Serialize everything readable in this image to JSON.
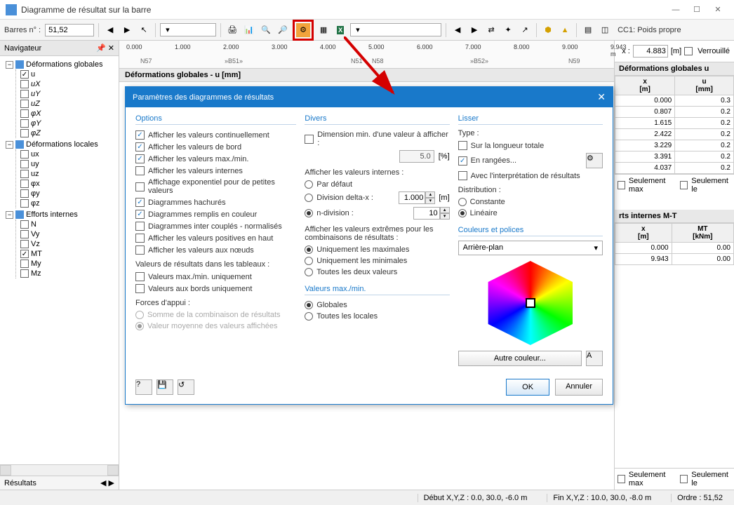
{
  "window": {
    "title": "Diagramme de résultat sur la barre"
  },
  "toolbar": {
    "barres_label": "Barres n° :",
    "barres_value": "51,52",
    "cc_label": "CC1: Poids propre"
  },
  "navigator": {
    "title": "Navigateur",
    "footer": "Résultats",
    "groups": [
      {
        "label": "Déformations globales",
        "expanded": true,
        "items": [
          {
            "label": "u",
            "checked": true
          },
          {
            "label": "uX",
            "checked": false,
            "style": "italic"
          },
          {
            "label": "uY",
            "checked": false,
            "style": "italic"
          },
          {
            "label": "uZ",
            "checked": false,
            "style": "italic"
          },
          {
            "label": "φX",
            "checked": false,
            "style": "italic"
          },
          {
            "label": "φY",
            "checked": false,
            "style": "italic"
          },
          {
            "label": "φZ",
            "checked": false,
            "style": "italic"
          }
        ]
      },
      {
        "label": "Déformations locales",
        "expanded": true,
        "items": [
          {
            "label": "ux",
            "checked": false
          },
          {
            "label": "uy",
            "checked": false
          },
          {
            "label": "uz",
            "checked": false
          },
          {
            "label": "φx",
            "checked": false
          },
          {
            "label": "φy",
            "checked": false
          },
          {
            "label": "φz",
            "checked": false
          }
        ]
      },
      {
        "label": "Efforts internes",
        "expanded": true,
        "items": [
          {
            "label": "N",
            "checked": false
          },
          {
            "label": "Vy",
            "checked": false
          },
          {
            "label": "Vz",
            "checked": false
          },
          {
            "label": "MT",
            "checked": true
          },
          {
            "label": "My",
            "checked": false
          },
          {
            "label": "Mz",
            "checked": false
          }
        ]
      }
    ]
  },
  "ruler": {
    "ticks": [
      "0.000",
      "1.000",
      "2.000",
      "3.000",
      "4.000",
      "5.000",
      "6.000",
      "7.000",
      "8.000",
      "9.000",
      "9.943 m"
    ],
    "nodes_left": [
      "N57",
      "»B51»"
    ],
    "nodes_mid": [
      "N51",
      "N58"
    ],
    "nodes_right": [
      "»B52»",
      "N59"
    ]
  },
  "section_header": "Déformations globales - u [mm]",
  "right": {
    "x_label": "x :",
    "x_value": "4.883",
    "x_unit": "[m]",
    "lock_label": "Verrouillé",
    "table1": {
      "title": "Déformations globales u",
      "col1": "x\n[m]",
      "col2": "u\n[mm]",
      "rows": [
        [
          "0.000",
          "0.3"
        ],
        [
          "0.807",
          "0.2"
        ],
        [
          "1.615",
          "0.2"
        ],
        [
          "2.422",
          "0.2"
        ],
        [
          "3.229",
          "0.2"
        ],
        [
          "3.391",
          "0.2"
        ],
        [
          "4.037",
          "0.2"
        ]
      ]
    },
    "table2": {
      "title": "rts internes M-T",
      "col1": "x\n[m]",
      "col2": "MT\n[kNm]",
      "rows": [
        [
          "0.000",
          "0.00"
        ],
        [
          "9.943",
          "0.00"
        ]
      ]
    },
    "footer_max": "Seulement max",
    "footer_le": "Seulement le"
  },
  "dialog": {
    "title": "Paramètres des diagrammes de résultats",
    "options": {
      "heading": "Options",
      "items": [
        {
          "label": "Afficher les valeurs continuellement",
          "checked": true
        },
        {
          "label": "Afficher les valeurs de bord",
          "checked": true
        },
        {
          "label": "Afficher les valeurs max./min.",
          "checked": true
        },
        {
          "label": "Afficher les valeurs internes",
          "checked": false
        },
        {
          "label": "Affichage exponentiel pour de petites valeurs",
          "checked": false
        },
        {
          "label": "Diagrammes hachurés",
          "checked": true
        },
        {
          "label": "Diagrammes remplis en couleur",
          "checked": true
        },
        {
          "label": "Diagrammes inter couplés - normalisés",
          "checked": false
        },
        {
          "label": "Afficher les valeurs positives en haut",
          "checked": false
        },
        {
          "label": "Afficher les valeurs aux nœuds",
          "checked": false
        }
      ],
      "tables_heading": "Valeurs de résultats dans les tableaux :",
      "tables_items": [
        {
          "label": "Valeurs max./min. uniquement",
          "checked": false
        },
        {
          "label": "Valeurs aux bords uniquement",
          "checked": false
        }
      ],
      "forces_heading": "Forces d'appui :",
      "forces_items": [
        {
          "label": "Somme de la combinaison de résultats",
          "checked": false,
          "disabled": true
        },
        {
          "label": "Valeur moyenne des valeurs affichées",
          "checked": true,
          "disabled": true
        }
      ]
    },
    "divers": {
      "heading": "Divers",
      "dim_label": "Dimension min. d'une valeur à afficher :",
      "dim_value": "5.0",
      "dim_unit": "[%]",
      "internes_label": "Afficher les valeurs internes :",
      "internes": [
        {
          "label": "Par défaut",
          "checked": false
        },
        {
          "label": "Division delta-x :",
          "checked": false,
          "value": "1.000",
          "unit": "[m]"
        },
        {
          "label": "n-division :",
          "checked": true,
          "value": "10"
        }
      ],
      "extremes_label": "Afficher les valeurs extrêmes pour les combinaisons de résultats :",
      "extremes": [
        {
          "label": "Uniquement les maximales",
          "checked": true
        },
        {
          "label": "Uniquement les minimales",
          "checked": false
        },
        {
          "label": "Toutes les deux valeurs",
          "checked": false
        }
      ],
      "maxmin_heading": "Valeurs max./min.",
      "maxmin": [
        {
          "label": "Globales",
          "checked": true
        },
        {
          "label": "Toutes les locales",
          "checked": false
        }
      ]
    },
    "lisser": {
      "heading": "Lisser",
      "type_label": "Type :",
      "type_items": [
        {
          "label": "Sur la longueur totale",
          "checked": false,
          "kind": "check"
        },
        {
          "label": "En rangées...",
          "checked": true,
          "kind": "check"
        },
        {
          "label": "Avec l'interprétation de résultats",
          "checked": false,
          "kind": "check"
        }
      ],
      "dist_label": "Distribution :",
      "dist_items": [
        {
          "label": "Constante",
          "checked": false
        },
        {
          "label": "Linéaire",
          "checked": true
        }
      ],
      "colors_heading": "Couleurs et polices",
      "select_value": "Arrière-plan",
      "other_color": "Autre couleur..."
    },
    "ok": "OK",
    "cancel": "Annuler"
  },
  "statusbar": {
    "debut": "Début X,Y,Z :  0.0, 30.0, -6.0 m",
    "fin": "Fin X,Y,Z :  10.0, 30.0, -8.0 m",
    "ordre": "Ordre :  51,52"
  }
}
